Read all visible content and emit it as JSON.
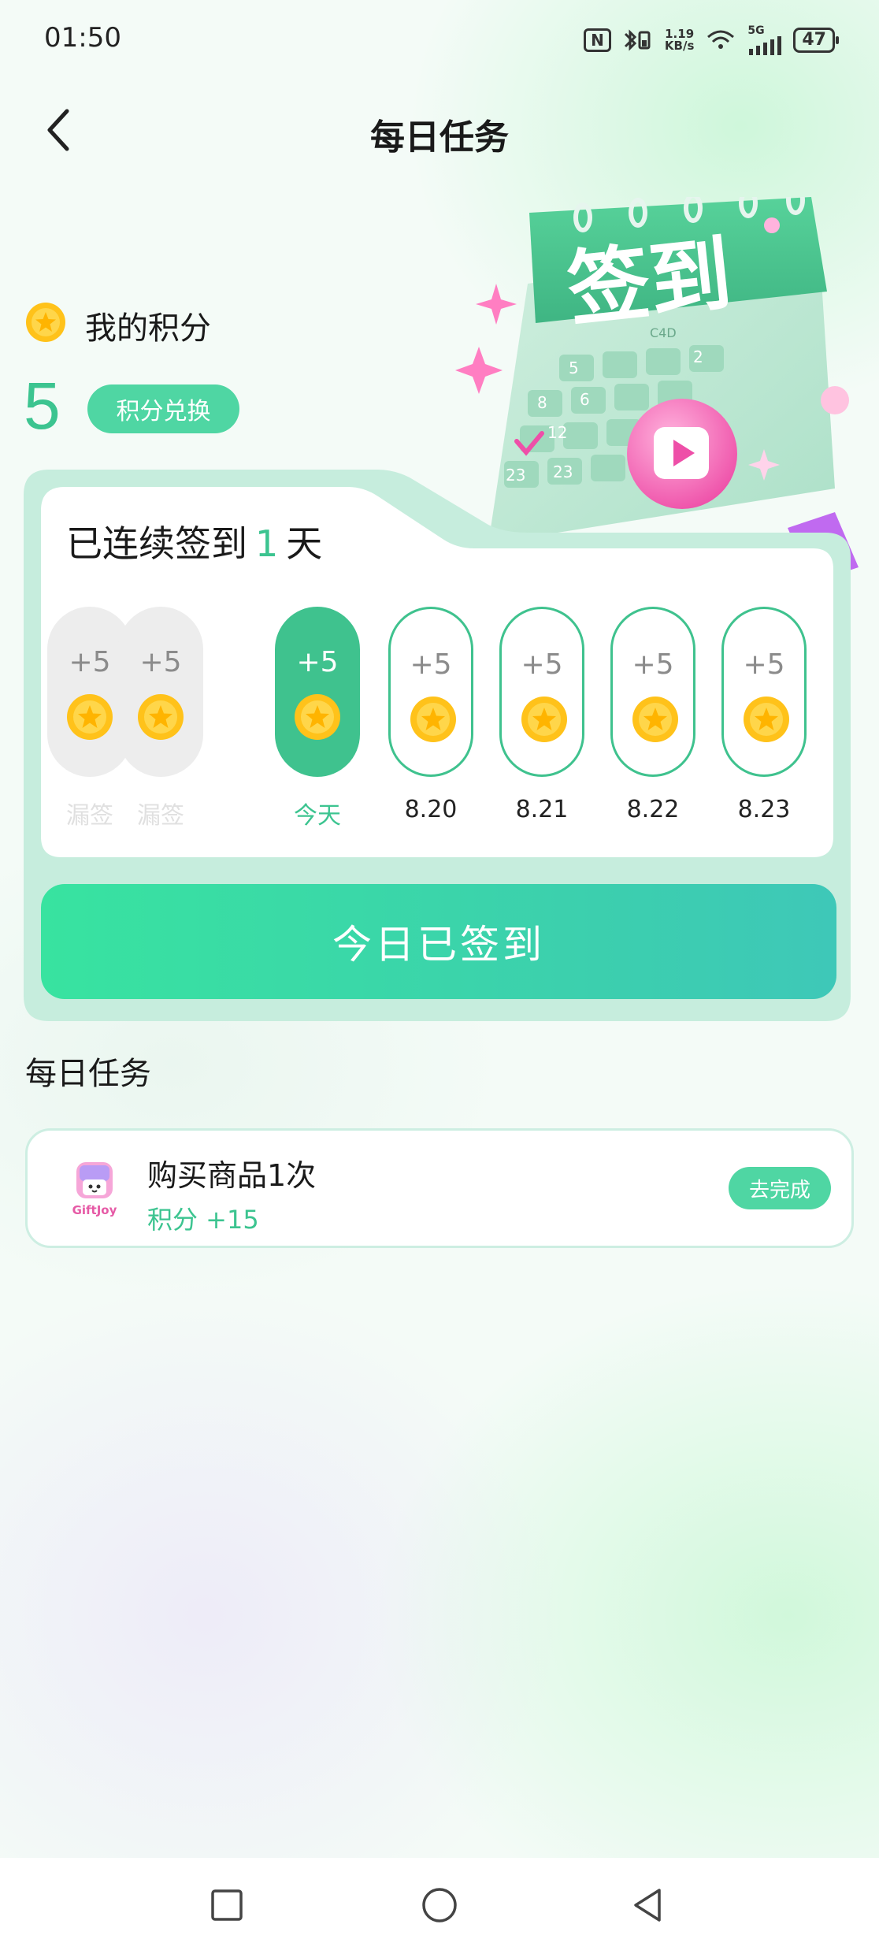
{
  "status": {
    "time": "01:50",
    "nfc": "N",
    "net_speed_value": "1.19",
    "net_speed_unit": "KB/s",
    "network": "5G",
    "battery": "47"
  },
  "header": {
    "title": "每日任务",
    "back_icon": "chevron-left-icon"
  },
  "points": {
    "label": "我的积分",
    "value": "5",
    "exchange_label": "积分兑换"
  },
  "illustration": {
    "title": "签到",
    "cal_numbers": [
      "5",
      "2",
      "8",
      "6",
      "12",
      "23",
      "23"
    ],
    "tag": "C4D",
    "badge": "¥"
  },
  "checkin": {
    "streak_prefix": "已连续签到",
    "streak_days": "1",
    "streak_suffix": "天",
    "days": [
      {
        "bonus": "+5",
        "label": "漏签",
        "state": "missed"
      },
      {
        "bonus": "+5",
        "label": "漏签",
        "state": "missed"
      },
      {
        "bonus": "+5",
        "label": "今天",
        "state": "today"
      },
      {
        "bonus": "+5",
        "label": "8.20",
        "state": "future"
      },
      {
        "bonus": "+5",
        "label": "8.21",
        "state": "future"
      },
      {
        "bonus": "+5",
        "label": "8.22",
        "state": "future"
      },
      {
        "bonus": "+5",
        "label": "8.23",
        "state": "future"
      }
    ],
    "button_label": "今日已签到"
  },
  "tasks": {
    "heading": "每日任务",
    "items": [
      {
        "icon_text": "GiftJoy",
        "title": "购买商品1次",
        "reward": "积分 +15",
        "action": "去完成"
      }
    ]
  },
  "navbar": {
    "recents_icon": "square-icon",
    "home_icon": "circle-icon",
    "back_icon": "triangle-back-icon"
  },
  "colors": {
    "accent": "#3cc490",
    "button_green": "#4fd6a3",
    "coin": "#ffc21a"
  }
}
